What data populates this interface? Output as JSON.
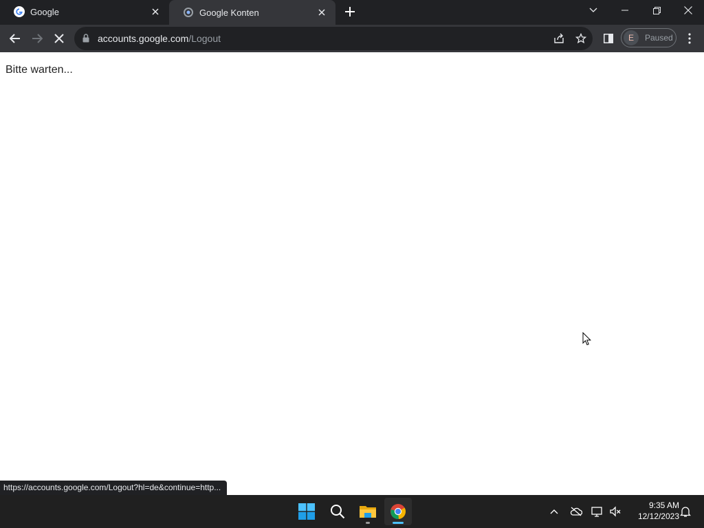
{
  "tabs": [
    {
      "title": "Google",
      "favicon": "google-g-icon",
      "active": false
    },
    {
      "title": "Google Konten",
      "favicon": "loading-globe-icon",
      "active": true
    }
  ],
  "toolbar": {
    "url_host": "accounts.google.com",
    "url_path": "/Logout",
    "profile_initial": "E",
    "profile_status": "Paused"
  },
  "page": {
    "message": "Bitte warten..."
  },
  "status_bar": {
    "text": "https://accounts.google.com/Logout?hl=de&continue=http..."
  },
  "taskbar": {
    "apps": [
      "windows-start-icon",
      "search-icon",
      "file-explorer-icon",
      "chrome-icon"
    ],
    "time": "9:35 AM",
    "date": "12/12/2023"
  },
  "colors": {
    "tabstrip_bg": "#202124",
    "toolbar_bg": "#35363a",
    "omnibox_bg": "#202124",
    "taskbar_bg": "#202020",
    "accent_blue": "#4cc2ff"
  }
}
